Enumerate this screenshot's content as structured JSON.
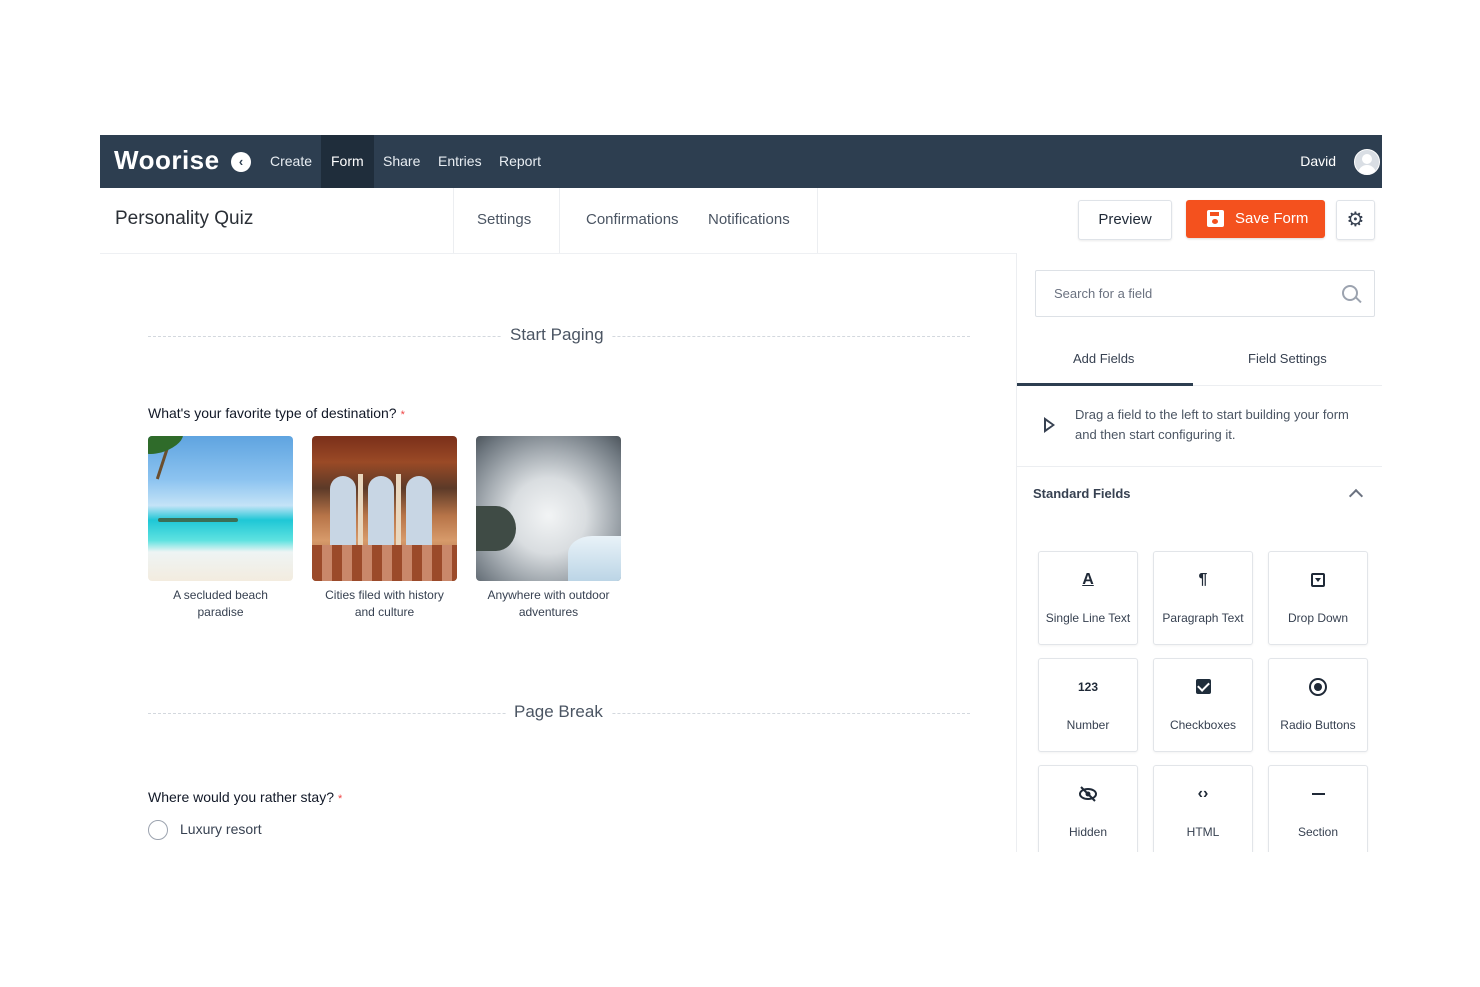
{
  "nav": {
    "logo": "Woorise",
    "back_icon": "chevron-left-icon",
    "items": [
      {
        "label": "Create",
        "active": false
      },
      {
        "label": "Form",
        "active": true
      },
      {
        "label": "Share",
        "active": false
      },
      {
        "label": "Entries",
        "active": false
      },
      {
        "label": "Report",
        "active": false
      }
    ],
    "user": "David"
  },
  "subheader": {
    "title": "Personality Quiz",
    "tabs": [
      "Settings",
      "Confirmations",
      "Notifications"
    ],
    "preview_label": "Preview",
    "save_label": "Save Form"
  },
  "canvas": {
    "start_paging": "Start Paging",
    "q1": "What's your favorite type of destination?",
    "choices": [
      {
        "line1": "A secluded beach",
        "line2": "paradise"
      },
      {
        "line1": "Cities filed with history",
        "line2": "and culture"
      },
      {
        "line1": "Anywhere with outdoor",
        "line2": "adventures"
      }
    ],
    "page_break": "Page Break",
    "q2": "Where would you rather stay?",
    "required_mark": "*",
    "radio_option": "Luxury resort"
  },
  "panel": {
    "search_placeholder": "Search for a field",
    "tabs": [
      "Add Fields",
      "Field Settings"
    ],
    "hint": "Drag a field to the left to start building your form and then start configuring it.",
    "section_title": "Standard Fields",
    "fields": [
      {
        "label": "Single Line Text",
        "icon": "text-icon"
      },
      {
        "label": "Paragraph Text",
        "icon": "paragraph-icon"
      },
      {
        "label": "Drop Down",
        "icon": "dropdown-icon"
      },
      {
        "label": "Number",
        "icon": "number-icon",
        "glyph": "123"
      },
      {
        "label": "Checkboxes",
        "icon": "checkbox-icon"
      },
      {
        "label": "Radio Buttons",
        "icon": "radio-icon"
      },
      {
        "label": "Hidden",
        "icon": "eye-slash-icon"
      },
      {
        "label": "HTML",
        "icon": "code-icon"
      },
      {
        "label": "Section",
        "icon": "dash-icon"
      }
    ]
  },
  "colors": {
    "nav_bg": "#2d3e50",
    "accent": "#f4511e",
    "required": "#ef4444"
  }
}
